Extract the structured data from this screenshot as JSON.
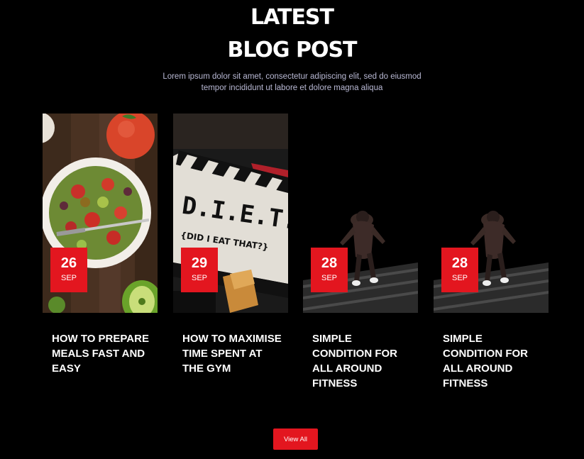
{
  "section": {
    "title_line1": "LATEST",
    "title_line2": "BLOG POST",
    "subtitle_line1": "Lorem ipsum dolor sit amet, consectetur adipiscing elit, sed do eiusmod",
    "subtitle_line2": "tempor incididunt ut labore et dolore magna aliqua"
  },
  "posts": [
    {
      "day": "26",
      "month": "SEP",
      "title": "HOW TO PREPARE MEALS FAST AND EASY",
      "image": "salad-bowl-photo"
    },
    {
      "day": "29",
      "month": "SEP",
      "title": "HOW TO MAXIMISE TIME SPENT AT THE GYM",
      "image": "diet-clapperboard-photo"
    },
    {
      "day": "28",
      "month": "SEP",
      "title": "SIMPLE CONDITION FOR ALL AROUND FITNESS",
      "image": "runner-stairs-photo"
    },
    {
      "day": "28",
      "month": "SEP",
      "title": "SIMPLE CONDITION FOR ALL AROUND FITNESS",
      "image": "runner-stairs-photo"
    }
  ],
  "view_all_label": "View All",
  "colors": {
    "accent": "#e3161f",
    "background": "#000000",
    "subtitle": "#b9b9d4"
  }
}
